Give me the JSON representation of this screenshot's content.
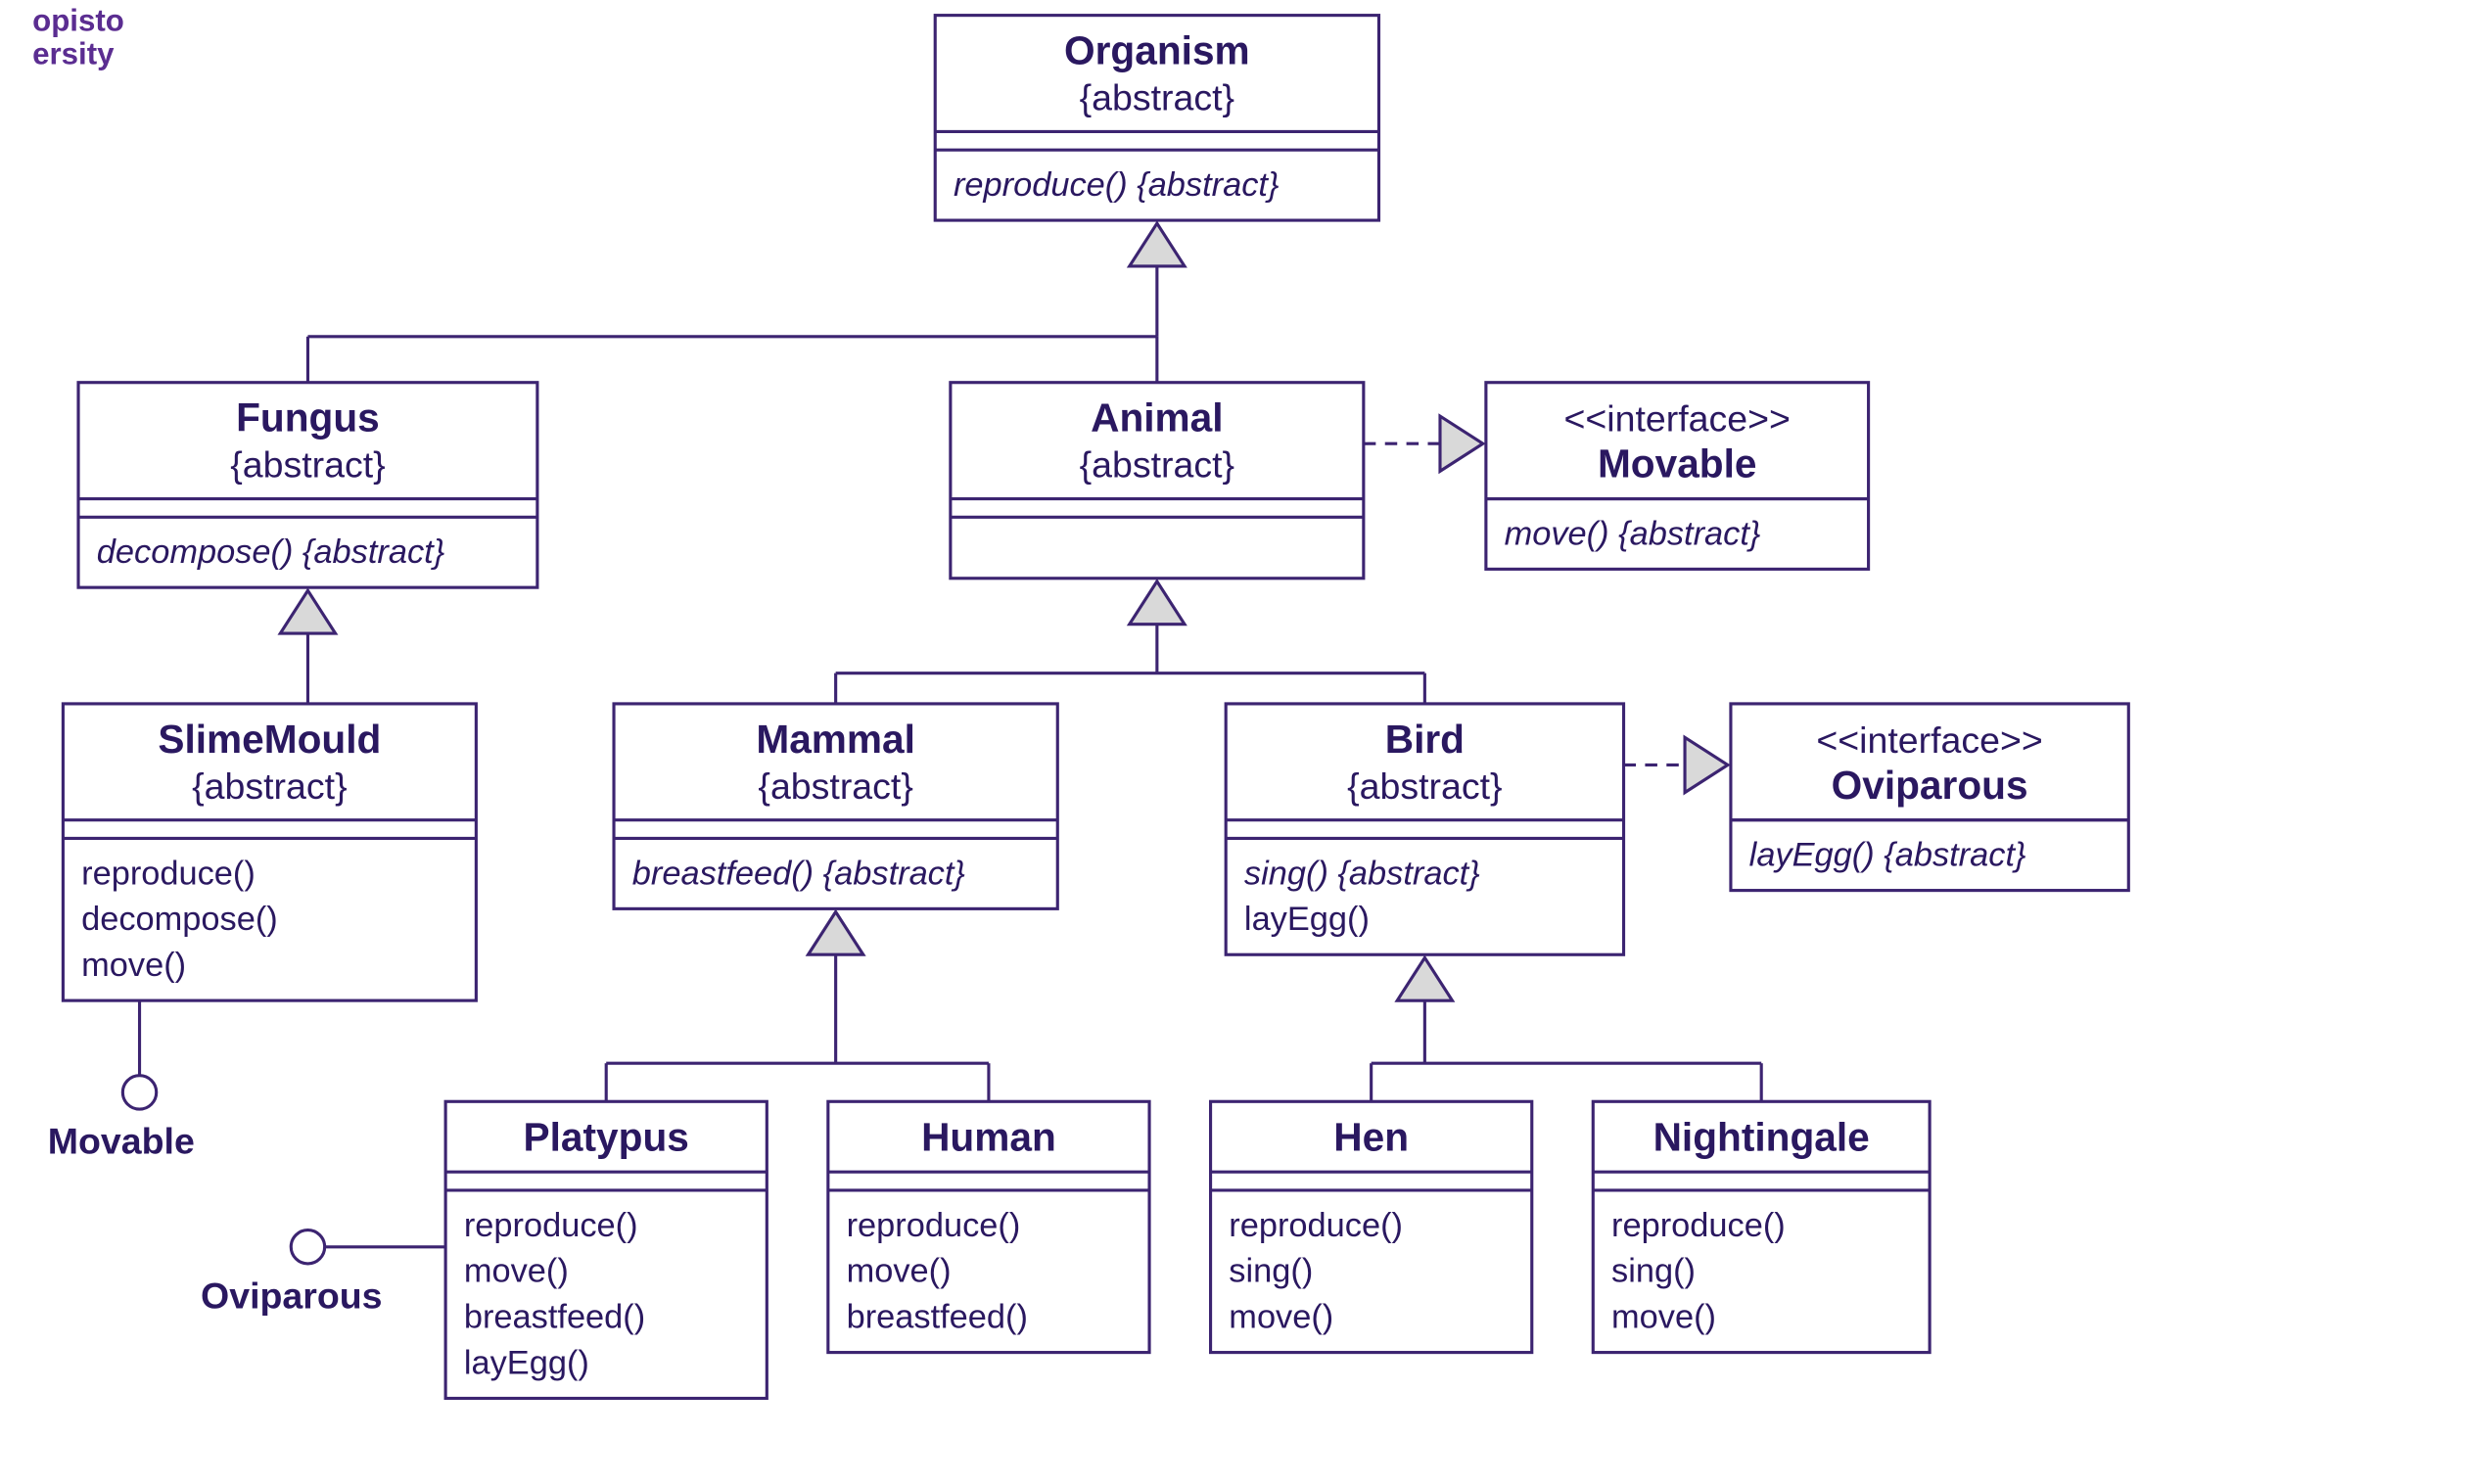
{
  "watermark": {
    "line1": "opisto",
    "line2": "ersity"
  },
  "colors": {
    "stroke": "#3c2471",
    "text": "#2a1860",
    "arrowFill": "#d9d9d9"
  },
  "classes": {
    "organism": {
      "name": "Organism",
      "stereotype": "{abstract}",
      "methods": [
        "reproduce() {abstract}"
      ],
      "methodStyles": [
        "italic"
      ]
    },
    "fungus": {
      "name": "Fungus",
      "stereotype": "{abstract}",
      "methods": [
        "decompose() {abstract}"
      ],
      "methodStyles": [
        "italic"
      ]
    },
    "animal": {
      "name": "Animal",
      "stereotype": "{abstract}",
      "methods": []
    },
    "movable": {
      "name": "Movable",
      "stereotypeTop": "<<interface>>",
      "methods": [
        "move() {abstract}"
      ],
      "methodStyles": [
        "italic"
      ]
    },
    "slime": {
      "name": "SlimeMould",
      "stereotype": "{abstract}",
      "methods": [
        "reproduce()",
        "decompose()",
        "move()"
      ]
    },
    "mammal": {
      "name": "Mammal",
      "stereotype": "{abstract}",
      "methods": [
        "breastfeed() {abstract}"
      ],
      "methodStyles": [
        "italic"
      ]
    },
    "bird": {
      "name": "Bird",
      "stereotype": "{abstract}",
      "methods": [
        "sing() {abstract}",
        "layEgg()"
      ],
      "methodStyles": [
        "italic",
        ""
      ]
    },
    "oviparous": {
      "name": "Oviparous",
      "stereotypeTop": "<<interface>>",
      "methods": [
        "layEgg() {abstract}"
      ],
      "methodStyles": [
        "italic"
      ]
    },
    "platypus": {
      "name": "Platypus",
      "methods": [
        "reproduce()",
        "move()",
        "breastfeed()",
        "layEgg()"
      ]
    },
    "human": {
      "name": "Human",
      "methods": [
        "reproduce()",
        "move()",
        "breastfeed()"
      ]
    },
    "hen": {
      "name": "Hen",
      "methods": [
        "reproduce()",
        "sing()",
        "move()"
      ]
    },
    "nightingale": {
      "name": "Nightingale",
      "methods": [
        "reproduce()",
        "sing()",
        "move()"
      ]
    }
  },
  "labels": {
    "movable": "Movable",
    "oviparous": "Oviparous"
  }
}
